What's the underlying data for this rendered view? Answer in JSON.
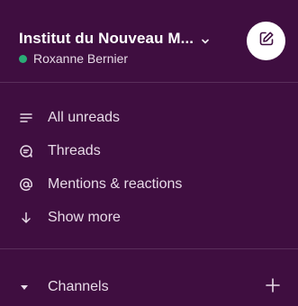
{
  "workspace": {
    "name": "Institut du Nouveau M...",
    "user": "Roxanne Bernier",
    "presence_color": "#2bac76"
  },
  "compose": {
    "icon": "compose-icon"
  },
  "nav": {
    "items": [
      {
        "label": "All unreads",
        "icon": "all-unreads-icon"
      },
      {
        "label": "Threads",
        "icon": "threads-icon"
      },
      {
        "label": "Mentions & reactions",
        "icon": "mention-icon"
      },
      {
        "label": "Show more",
        "icon": "arrow-down-icon"
      }
    ]
  },
  "channels": {
    "label": "Channels",
    "add_icon": "plus-icon"
  },
  "theme": {
    "sidebar_bg": "#3f0e40",
    "text": "#e8dbe8",
    "divider": "#5a2e5b"
  }
}
